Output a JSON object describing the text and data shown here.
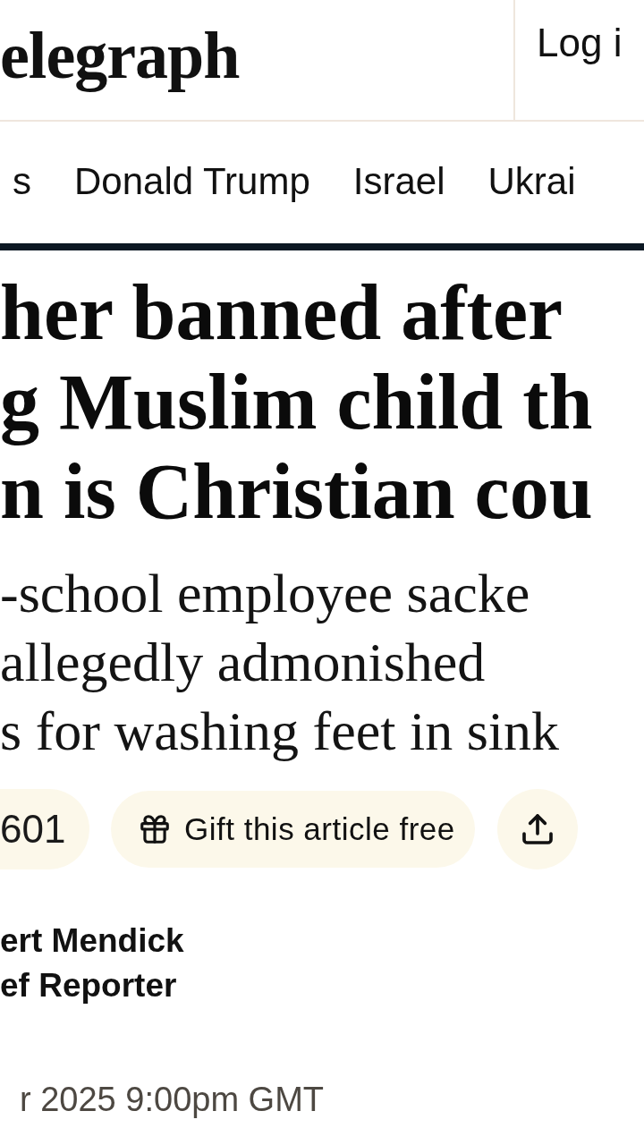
{
  "header": {
    "logo": "elegraph",
    "login": "Log i"
  },
  "nav": {
    "items": [
      {
        "label": "s"
      },
      {
        "label": "Donald Trump"
      },
      {
        "label": "Israel"
      },
      {
        "label": "Ukrai"
      }
    ]
  },
  "article": {
    "headline": [
      "her banned after",
      "g Muslim child th",
      "n is Christian cou"
    ],
    "standfirst": [
      "-school employee sacke",
      "allegedly admonished",
      "s for washing feet in sink"
    ],
    "actions": [
      {
        "kind": "comments",
        "label": "601"
      },
      {
        "kind": "gift",
        "label": "Gift this article free"
      },
      {
        "kind": "share"
      }
    ],
    "byline": {
      "name": "ert Mendick",
      "role": "ef Reporter"
    },
    "date": "r 2025 9:00pm GMT"
  }
}
